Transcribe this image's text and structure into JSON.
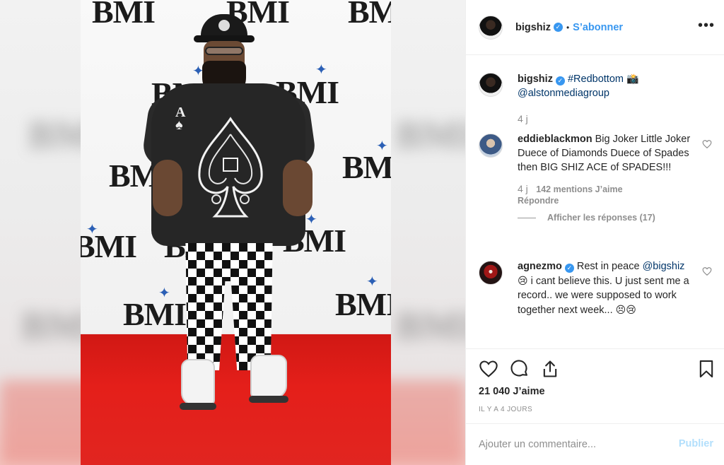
{
  "post": {
    "username": "bigshiz",
    "follow_label": "S’abonner",
    "more_label": "•••"
  },
  "photo": {
    "backdrop_brand": "BMI",
    "card_rank": "A"
  },
  "comments": [
    {
      "username": "bigshiz",
      "verified": true,
      "text_hashtag": "#Redbottom",
      "text_emoji": "📸",
      "text_mention": "@alstonmediagroup",
      "time": "4 j"
    },
    {
      "username": "eddieblackmon",
      "verified": false,
      "text": "Big Joker Little Joker Duece of Diamonds Duece of Spades then BIG SHIZ ACE of SPADES!!!",
      "time": "4 j",
      "likes": "142 mentions J’aime",
      "reply_label": "Répondre",
      "view_replies": "Afficher les réponses (17)"
    },
    {
      "username": "agnezmo",
      "verified": true,
      "text_pre": "Rest in peace",
      "text_mention": "@bigshiz",
      "text_emoji1": "😢",
      "text_post": "i cant believe this. U just sent me a record.. we were supposed to work together next week...",
      "text_emoji2": "😣😢"
    }
  ],
  "actions": {
    "likes": "21 040 J’aime",
    "date": "IL Y A 4 JOURS"
  },
  "add_comment": {
    "placeholder": "Ajouter un commentaire...",
    "publish_label": "Publier"
  },
  "colors": {
    "accent": "#3897f0",
    "link": "#003569",
    "muted": "#8e8e8e",
    "carpet": "#e21f1a"
  },
  "icons": [
    "heart-icon",
    "comment-icon",
    "share-icon",
    "bookmark-icon",
    "more-icon",
    "verified-icon"
  ]
}
